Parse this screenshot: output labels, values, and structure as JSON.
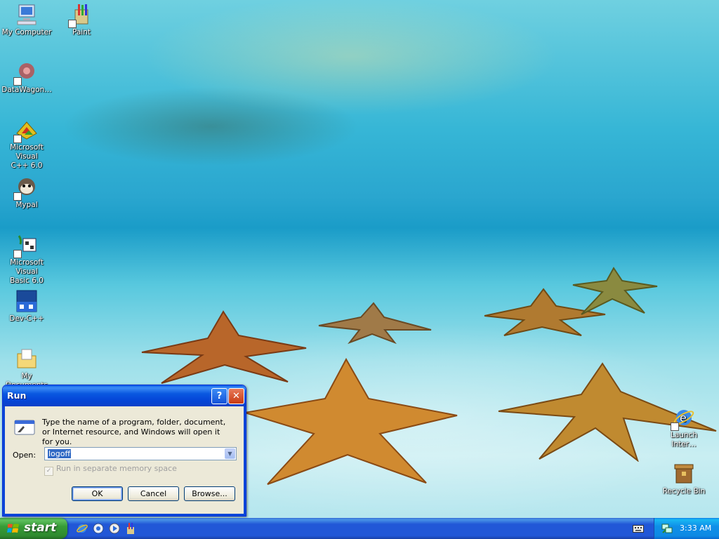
{
  "desktop": {
    "icons": {
      "my_computer": "My Computer",
      "paint": "Paint",
      "datawagon": "DataWagon…",
      "msvc_line1": "Microsoft Visual",
      "msvc_line2": "C++ 6.0",
      "mypal": "Mypal",
      "msvb_line1": "Microsoft Visual",
      "msvb_line2": "Basic 6.0",
      "devcpp": "Dev-C++",
      "my_documents": "My Documents",
      "launch_line1": "Launch",
      "launch_line2": "Inter…",
      "recycle_bin": "Recycle Bin"
    }
  },
  "run_dialog": {
    "title": "Run",
    "help_glyph": "?",
    "close_glyph": "✕",
    "description": "Type the name of a program, folder, document, or Internet resource, and Windows will open it for you.",
    "open_label": "Open:",
    "open_value": "logoff",
    "dropdown_glyph": "▼",
    "checkbox_label": "Run in separate memory space",
    "checkbox_glyph": "✓",
    "ok_label": "OK",
    "cancel_label": "Cancel",
    "browse_label": "Browse..."
  },
  "taskbar": {
    "start_label": "start",
    "clock": "3:33 AM"
  },
  "colors": {
    "title_bar": "#0a58e0",
    "taskbar": "#2157d7",
    "start_button": "#379c37",
    "tray": "#0f8fe8",
    "dialog_face": "#ece9d8",
    "selection": "#316ac5"
  }
}
